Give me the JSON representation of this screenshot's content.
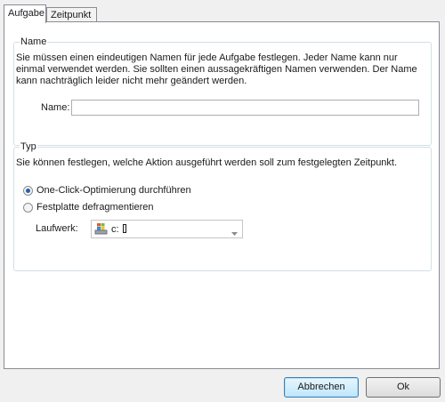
{
  "tabs": [
    {
      "label": "Aufgabe",
      "active": true
    },
    {
      "label": "Zeitpunkt",
      "active": false
    }
  ],
  "name_group": {
    "title": "Name",
    "description": "Sie müssen einen eindeutigen Namen für jede Aufgabe festlegen. Jeder Name kann nur einmal verwendet werden. Sie sollten einen aussagekräftigen Namen verwenden. Der Name kann nachträglich leider nicht mehr geändert werden.",
    "name_label": "Name:",
    "name_value": ""
  },
  "typ_group": {
    "title": "Typ",
    "description": "Sie können festlegen, welche Aktion ausgeführt werden soll zum festgelegten Zeitpunkt.",
    "options": [
      {
        "label": "One-Click-Optimierung durchführen",
        "checked": true
      },
      {
        "label": "Festplatte defragmentieren",
        "checked": false
      }
    ],
    "drive_label": "Laufwerk:",
    "drive_value": "c:",
    "drive_icon": "windows-drive-icon"
  },
  "buttons": {
    "cancel": "Abbrechen",
    "ok": "Ok"
  },
  "colors": {
    "accent": "#3c7fb1",
    "radio_dot": "#2b5fa8",
    "group_border": "#d5dfe5"
  }
}
